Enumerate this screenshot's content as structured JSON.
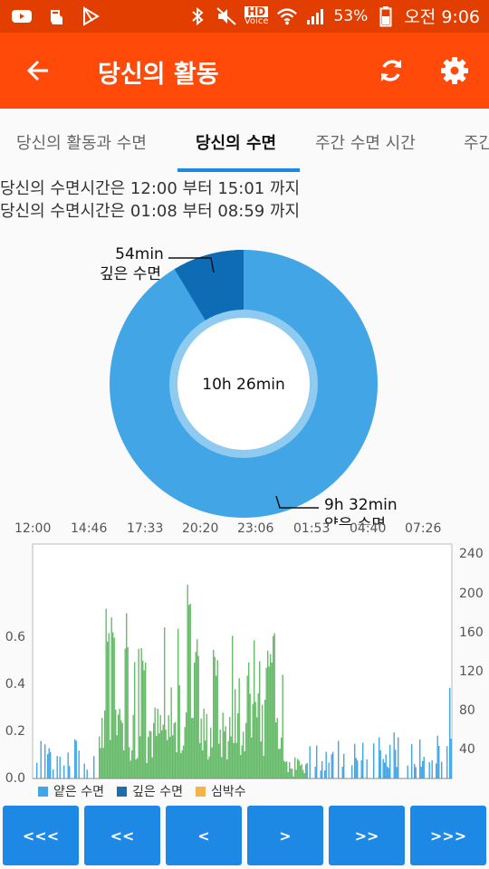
{
  "status_bar": {
    "battery": "53%",
    "time": "오전 9:06",
    "hd_label": "HD",
    "voice_label": "Voice"
  },
  "appbar": {
    "title": "당신의 활동"
  },
  "tabs": [
    {
      "label": "당신의 활동과 수면",
      "active": false
    },
    {
      "label": "당신의 수면",
      "active": true
    },
    {
      "label": "주간 수면 시간",
      "active": false
    },
    {
      "label": "주간",
      "active": false
    }
  ],
  "sleep_info": [
    "당신의 수면시간은 12:00 부터 15:01 까지",
    "당신의 수면시간은 01:08 부터 08:59 까지"
  ],
  "donut": {
    "center_label": "10h 26min",
    "deep_label_time": "54min",
    "deep_label_name": "깊은 수면",
    "light_label_time": "9h 32min",
    "light_label_name": "얕은 수면"
  },
  "chart_data": {
    "type": "area",
    "x_ticks": [
      "12:00",
      "14:46",
      "17:33",
      "20:20",
      "23:06",
      "01:53",
      "04:40",
      "07:26"
    ],
    "y_left_ticks": [
      "0.0",
      "0.2",
      "0.4",
      "0.6"
    ],
    "y_right_ticks": [
      "40",
      "80",
      "120",
      "160",
      "200",
      "240"
    ],
    "y_left_lim": [
      0,
      1
    ],
    "y_right_lim": [
      0,
      240
    ],
    "legend_position": "bottom-left",
    "series": [
      {
        "name": "얕은 수면",
        "color": "#42a5e6"
      },
      {
        "name": "깊은 수면",
        "color": "#1a6fb0"
      },
      {
        "name": "심박수",
        "color": "#f5b34a"
      }
    ],
    "activity_color": "#66bb6a",
    "donut": [
      {
        "name": "얕은 수면",
        "minutes": 572,
        "color": "#42a5e6"
      },
      {
        "name": "깊은 수면",
        "minutes": 54,
        "color": "#0d6cb3"
      }
    ]
  },
  "nav_buttons": [
    "<<<",
    "<<",
    "<",
    ">",
    ">>",
    ">>>"
  ],
  "colors": {
    "status_bar": "#e13e00",
    "app_bar": "#ff4a0a",
    "accent": "#1e88e5"
  }
}
